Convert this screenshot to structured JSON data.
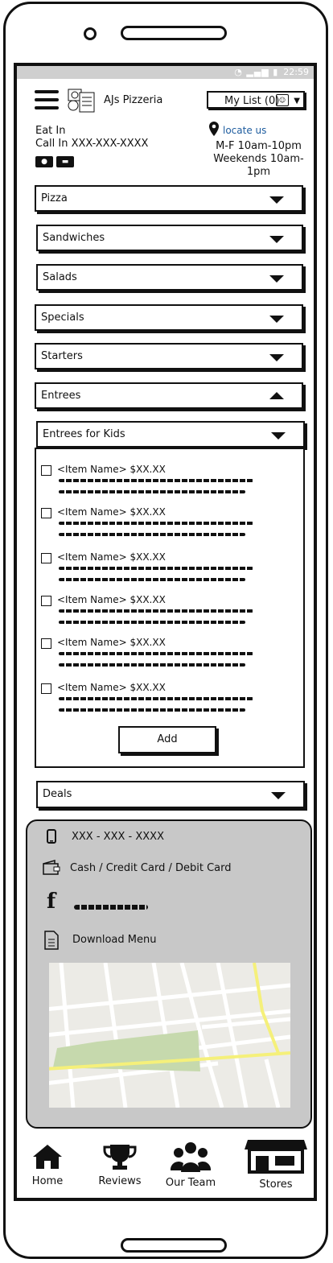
{
  "status_bar": {
    "time": "22:59"
  },
  "header": {
    "app_name": "AJs Pizzeria",
    "my_list_label": "My List (0)",
    "dine_in": "Eat In",
    "call_in": "Call In XXX-XXX-XXXX",
    "locate_label": "locate us",
    "hours_weekday": "M-F 10am-10pm",
    "hours_weekend": "Weekends 10am-1pm"
  },
  "menu": {
    "categories": [
      "Pizza",
      "Sandwiches",
      "Salads",
      "Specials",
      "Starters",
      "Entrees"
    ],
    "subcategory": "Entrees for Kids",
    "items": [
      {
        "label": "<Item Name> $XX.XX"
      },
      {
        "label": "<Item Name> $XX.XX"
      },
      {
        "label": "<Item Name> $XX.XX"
      },
      {
        "label": "<Item Name> $XX.XX"
      },
      {
        "label": "<Item Name> $XX.XX"
      },
      {
        "label": "<Item Name> $XX.XX"
      }
    ],
    "add_label": "Add",
    "deals_label": "Deals"
  },
  "footer": {
    "phone": "XXX - XXX - XXXX",
    "payment": "Cash / Credit Card / Debit Card",
    "download": "Download Menu"
  },
  "nav": [
    {
      "label": "Home",
      "icon": "home-icon"
    },
    {
      "label": "Reviews",
      "icon": "trophy-icon"
    },
    {
      "label": "Our Team",
      "icon": "team-icon"
    },
    {
      "label": "Stores",
      "icon": "store-icon"
    }
  ]
}
